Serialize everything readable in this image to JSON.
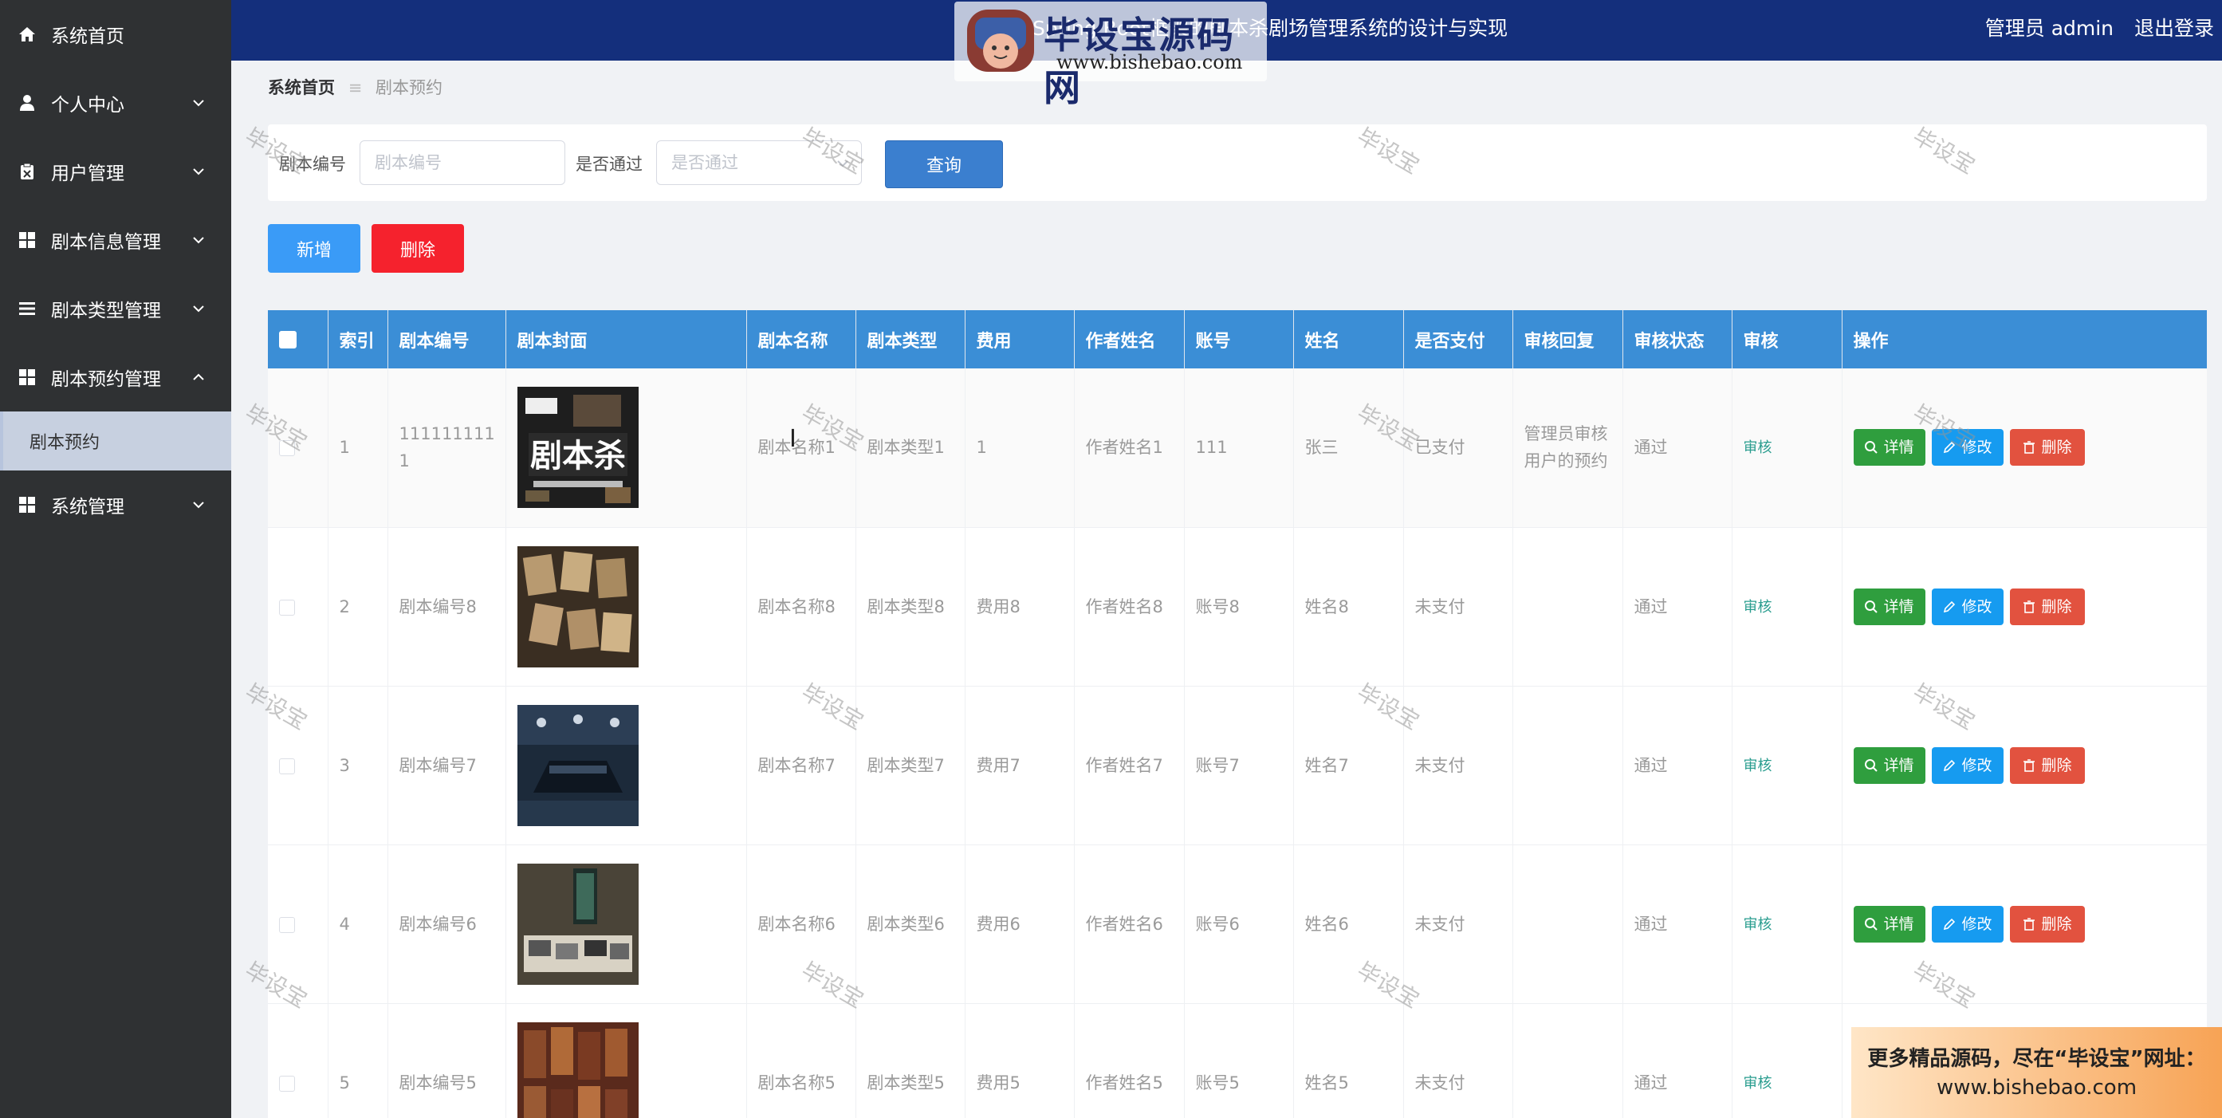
{
  "sidebar": {
    "items": [
      {
        "label": "系统首页",
        "icon": "home-icon"
      },
      {
        "label": "个人中心",
        "icon": "user-icon"
      },
      {
        "label": "用户管理",
        "icon": "clipboard-icon"
      },
      {
        "label": "剧本信息管理",
        "icon": "grid-icon"
      },
      {
        "label": "剧本类型管理",
        "icon": "list-icon"
      },
      {
        "label": "剧本预约管理",
        "icon": "grid-icon"
      },
      {
        "label": "系统管理",
        "icon": "grid-icon"
      }
    ],
    "active_sub": "剧本预约"
  },
  "header": {
    "title": "基于Spring Boot框架的剧本杀剧场管理系统的设计与实现",
    "admin": "管理员 admin",
    "logout": "退出登录"
  },
  "logo_watermark": {
    "name": "毕设宝源码网",
    "url": "www.bishebao.com"
  },
  "breadcrumb": {
    "home": "系统首页",
    "current": "剧本预约"
  },
  "search": {
    "field1_label": "剧本编号",
    "field1_placeholder": "剧本编号",
    "field2_label": "是否通过",
    "field2_placeholder": "是否通过",
    "query_button": "查询"
  },
  "actions": {
    "add": "新增",
    "delete": "删除"
  },
  "table": {
    "headers": [
      "索引",
      "剧本编号",
      "剧本封面",
      "剧本名称",
      "剧本类型",
      "费用",
      "作者姓名",
      "账号",
      "姓名",
      "是否支付",
      "审核回复",
      "审核状态",
      "审核",
      "操作"
    ],
    "rows": [
      {
        "index": "1",
        "code": "1111111111",
        "name": "剧本名称1",
        "type": "剧本类型1",
        "fee": "1",
        "author": "作者姓名1",
        "account": "111",
        "person": "张三",
        "paid": "已支付",
        "reply": "管理员审核用户的预约",
        "status": "通过",
        "audit": "审核"
      },
      {
        "index": "2",
        "code": "剧本编号8",
        "name": "剧本名称8",
        "type": "剧本类型8",
        "fee": "费用8",
        "author": "作者姓名8",
        "account": "账号8",
        "person": "姓名8",
        "paid": "未支付",
        "reply": "",
        "status": "通过",
        "audit": "审核"
      },
      {
        "index": "3",
        "code": "剧本编号7",
        "name": "剧本名称7",
        "type": "剧本类型7",
        "fee": "费用7",
        "author": "作者姓名7",
        "account": "账号7",
        "person": "姓名7",
        "paid": "未支付",
        "reply": "",
        "status": "通过",
        "audit": "审核"
      },
      {
        "index": "4",
        "code": "剧本编号6",
        "name": "剧本名称6",
        "type": "剧本类型6",
        "fee": "费用6",
        "author": "作者姓名6",
        "account": "账号6",
        "person": "姓名6",
        "paid": "未支付",
        "reply": "",
        "status": "通过",
        "audit": "审核"
      },
      {
        "index": "5",
        "code": "剧本编号5",
        "name": "剧本名称5",
        "type": "剧本类型5",
        "fee": "费用5",
        "author": "作者姓名5",
        "account": "账号5",
        "person": "姓名5",
        "paid": "未支付",
        "reply": "",
        "status": "通过",
        "audit": "审核"
      }
    ],
    "op_detail": "详情",
    "op_edit": "修改",
    "op_delete": "删除"
  },
  "watermark_text": "毕设宝",
  "promo": {
    "line1": "更多精品源码，尽在“毕设宝”网址：",
    "line2": "www.bishebao.com"
  },
  "colors": {
    "header": "#142f7c",
    "sidebar": "#2f3133",
    "table_header": "#3b8ed6",
    "add": "#3a9bf7",
    "delete": "#f5222d"
  }
}
